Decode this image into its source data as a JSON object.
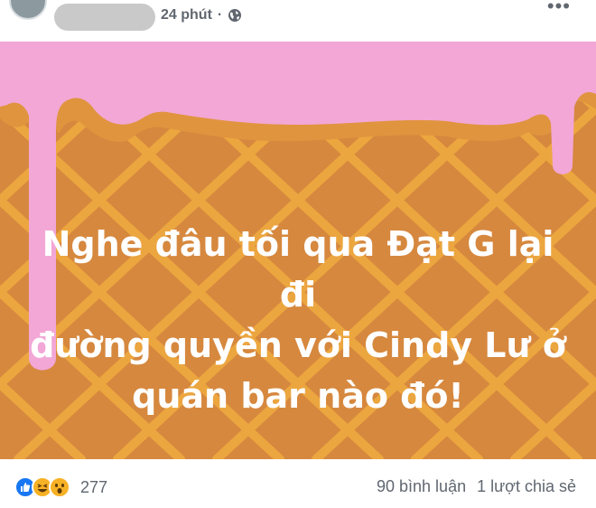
{
  "post": {
    "time": "24 phút",
    "privacy_icon": "globe-icon",
    "more_icon": "more-horizontal-icon",
    "text_lines": [
      "Nghe đâu tối qua Đạt G lại đi",
      "đường quyền với Cindy Lư ở",
      "quán bar nào đó!"
    ],
    "background": {
      "cone_color": "#d6883e",
      "waffle_line_color": "#eca63f",
      "drip_color": "#f2a7d6",
      "drip_shadow_color": "#e0943e"
    }
  },
  "footer": {
    "reaction_icons": [
      "like-icon",
      "haha-icon",
      "wow-icon"
    ],
    "reaction_count": "277",
    "comments": "90 bình luận",
    "shares": "1 lượt chia sẻ"
  }
}
